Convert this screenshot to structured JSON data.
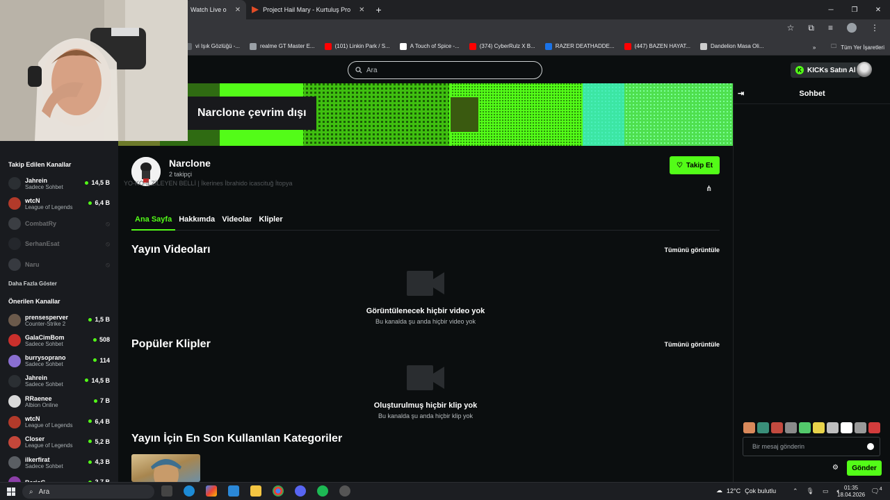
{
  "browser": {
    "tabs": [
      {
        "label": "Watch Live o",
        "active": true
      },
      {
        "label": "Project Hail Mary - Kurtuluş Pro",
        "active": false
      }
    ],
    "bookmarks": [
      {
        "label": "vi Işık Gözlüğü -...",
        "color": "#5f6368"
      },
      {
        "label": "realme GT Master E...",
        "color": "#9aa0a6"
      },
      {
        "label": "(101) Linkin Park / S...",
        "color": "#ff0000"
      },
      {
        "label": "A Touch of Spice -...",
        "color": "#ffffff"
      },
      {
        "label": "(374) CyberRulz X B...",
        "color": "#ff0000"
      },
      {
        "label": "RAZER DEATHADDE...",
        "color": "#1a73e8"
      },
      {
        "label": "(447) BAZEN HAYAT...",
        "color": "#ff0000"
      },
      {
        "label": "Dandelion Masa Oli...",
        "color": "#cccccc"
      }
    ],
    "bookmarks_more": "»",
    "all_bookmarks": "Tüm Yer İşaretleri"
  },
  "header": {
    "search_placeholder": "Ara",
    "kicks_label": "KICKs Satın Al"
  },
  "sidebar": {
    "followed_title": "Takip Edilen Kanallar",
    "followed": [
      {
        "name": "Jahrein",
        "category": "Sadece Sohbet",
        "viewers": "14,5 B",
        "live": true,
        "color": "#2b2f33"
      },
      {
        "name": "wtcN",
        "category": "League of Legends",
        "viewers": "6,4 B",
        "live": true,
        "color": "#b23a2a"
      },
      {
        "name": "CombatRy",
        "category": "",
        "viewers": "",
        "live": false,
        "color": "#7a8088"
      },
      {
        "name": "SerhanEsat",
        "category": "",
        "viewers": "",
        "live": false,
        "color": "#3a3f44"
      },
      {
        "name": "Naru",
        "category": "",
        "viewers": "",
        "live": false,
        "color": "#6f767d"
      }
    ],
    "show_more": "Daha Fazla Göster",
    "recommended_title": "Önerilen Kanallar",
    "recommended": [
      {
        "name": "prensesperver",
        "category": "Counter-Strike 2",
        "viewers": "1,5 B",
        "color": "#6b5a4b"
      },
      {
        "name": "GalaCimBom",
        "category": "Sadece Sohbet",
        "viewers": "508",
        "color": "#c9302c"
      },
      {
        "name": "burrysoprano",
        "category": "Sadece Sohbet",
        "viewers": "114",
        "color": "#8a6fd1"
      },
      {
        "name": "Jahrein",
        "category": "Sadece Sohbet",
        "viewers": "14,5 B",
        "color": "#2b2f33"
      },
      {
        "name": "RRaenee",
        "category": "Albion Online",
        "viewers": "7 B",
        "color": "#d9d9d9"
      },
      {
        "name": "wtcN",
        "category": "League of Legends",
        "viewers": "6,4 B",
        "color": "#b23a2a"
      },
      {
        "name": "Closer",
        "category": "League of Legends",
        "viewers": "5,2 B",
        "color": "#c4473a"
      },
      {
        "name": "ilkerfirat",
        "category": "Sadece Sohbet",
        "viewers": "4,3 B",
        "color": "#5a5e63"
      },
      {
        "name": "BarisG",
        "category": "",
        "viewers": "2,7 B",
        "color": "#8c3fa8"
      }
    ]
  },
  "banner": {
    "offline_text": "Narclone çevrim dışı"
  },
  "channel": {
    "name": "Narclone",
    "followers": "2 takipçi",
    "bio": "YO-KO-İLZİLEYEN BELLİ | İkerines İbrahido icascituğ İtopya",
    "follow_label": "Takip Et",
    "tabs": [
      {
        "label": "Ana Sayfa",
        "active": true
      },
      {
        "label": "Hakkımda",
        "active": false
      },
      {
        "label": "Videolar",
        "active": false
      },
      {
        "label": "Klipler",
        "active": false
      }
    ]
  },
  "sections": {
    "videos": {
      "title": "Yayın Videoları",
      "see_all": "Tümünü görüntüle",
      "empty_title": "Görüntülenecek hiçbir video yok",
      "empty_sub": "Bu kanalda şu anda hiçbir video yok"
    },
    "clips": {
      "title": "Popüler Klipler",
      "see_all": "Tümünü görüntüle",
      "empty_title": "Oluşturulmuş hiçbir klip yok",
      "empty_sub": "Bu kanalda şu anda hiçbir klip yok"
    },
    "categories": {
      "title": "Yayın İçin En Son Kullanılan Kategoriler"
    }
  },
  "chat": {
    "title": "Sohbet",
    "input_placeholder": "Bir mesaj gönderin",
    "send_label": "Gönder",
    "emote_colors": [
      "#d9895b",
      "#3a8f7a",
      "#c24a3f",
      "#8a8a8a",
      "#53c96b",
      "#e8d34a",
      "#bfbfbf",
      "#ffffff",
      "#999999",
      "#d23c3c"
    ]
  },
  "taskbar": {
    "search_label": "Ara",
    "temperature": "12°C",
    "weather": "Çok bulutlu",
    "time": "01:35",
    "date": "18.04.2026",
    "notifications": "4"
  },
  "colors": {
    "accent": "#53fc18",
    "background": "#0b0e0f",
    "sidebar": "#191b1f"
  }
}
